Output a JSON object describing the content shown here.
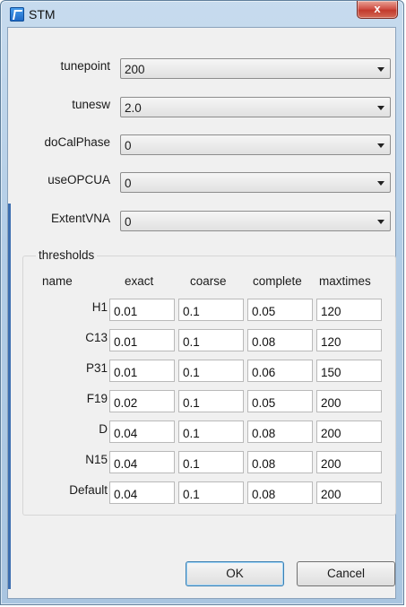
{
  "window": {
    "title": "STM",
    "close_glyph": "x"
  },
  "combos": [
    {
      "label": "tunepoint",
      "value": "200"
    },
    {
      "label": "tunesw",
      "value": "2.0"
    },
    {
      "label": "doCalPhase",
      "value": "0"
    },
    {
      "label": "useOPCUA",
      "value": "0"
    },
    {
      "label": "ExtentVNA",
      "value": "0"
    }
  ],
  "thresholds": {
    "title": "thresholds",
    "headers": [
      "name",
      "exact",
      "coarse",
      "complete",
      "maxtimes"
    ],
    "rows": [
      {
        "name": "H1",
        "values": [
          "0.01",
          "0.1",
          "0.05",
          "120"
        ]
      },
      {
        "name": "C13",
        "values": [
          "0.01",
          "0.1",
          "0.08",
          "120"
        ]
      },
      {
        "name": "P31",
        "values": [
          "0.01",
          "0.1",
          "0.06",
          "150"
        ]
      },
      {
        "name": "F19",
        "values": [
          "0.02",
          "0.1",
          "0.05",
          "200"
        ]
      },
      {
        "name": "D",
        "values": [
          "0.04",
          "0.1",
          "0.08",
          "200"
        ]
      },
      {
        "name": "N15",
        "values": [
          "0.04",
          "0.1",
          "0.08",
          "200"
        ]
      },
      {
        "name": "Default",
        "values": [
          "0.04",
          "0.1",
          "0.08",
          "200"
        ]
      }
    ]
  },
  "buttons": {
    "ok": "OK",
    "cancel": "Cancel"
  }
}
